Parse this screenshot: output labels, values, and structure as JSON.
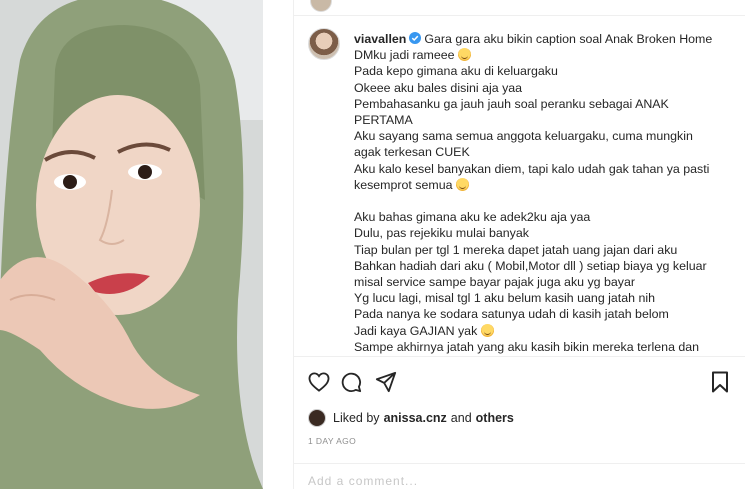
{
  "post": {
    "username": "viavallen",
    "caption_lines": [
      {
        "text": "Gara gara aku bikin caption soal Anak Broken Home",
        "first": true
      },
      {
        "text": "DMku jadi rameee",
        "emoji": "grinning-sweat-emoji"
      },
      {
        "text": "Pada kepo gimana aku di keluargaku"
      },
      {
        "text": "Okeee aku bales disini aja yaa"
      },
      {
        "text": "Pembahasanku ga jauh jauh soal peranku sebagai ANAK"
      },
      {
        "text": "PERTAMA"
      },
      {
        "text": "Aku sayang sama semua anggota keluargaku, cuma mungkin"
      },
      {
        "text": "agak terkesan CUEK"
      },
      {
        "text": "Aku kalo kesel banyakan diem, tapi kalo udah gak tahan ya pasti"
      },
      {
        "text": "kesemprot semua",
        "emoji": "grinning-sweat-emoji"
      },
      {
        "text": "",
        "gap": true
      },
      {
        "text": "Aku bahas gimana aku ke adek2ku aja yaa"
      },
      {
        "text": "Dulu, pas rejekiku mulai banyak"
      },
      {
        "text": "Tiap bulan per tgl 1 mereka dapet jatah uang jajan dari aku"
      },
      {
        "text": "Bahkan hadiah dari aku ( Mobil,Motor dll ) setiap biaya yg keluar"
      },
      {
        "text": "misal service sampe bayar pajak juga aku yg bayar"
      },
      {
        "text": "Yg lucu lagi, misal tgl 1 aku belum kasih uang jatah nih"
      },
      {
        "text": "Pada nanya ke sodara satunya udah di kasih jatah belom"
      },
      {
        "text": "Jadi kaya GAJIAN yak",
        "emoji": "rolling-laugh-emoji"
      },
      {
        "text": "Sampe akhirnya jatah yang aku kasih bikin mereka terlena dan"
      }
    ]
  },
  "likes": {
    "prefix": "Liked by",
    "user": "anissa.cnz",
    "joiner": "and",
    "others": "others"
  },
  "timestamp": "1 DAY AGO",
  "comment_ghost": "Add a comment...",
  "icons": {
    "like": "heart-icon",
    "comment": "comment-icon",
    "share": "send-icon",
    "save": "bookmark-icon",
    "verified": "verified-badge-icon"
  },
  "colors": {
    "verified": "#3897f0",
    "text": "#262626",
    "muted": "#8e8e8e",
    "hijab": "#8fa07a"
  }
}
